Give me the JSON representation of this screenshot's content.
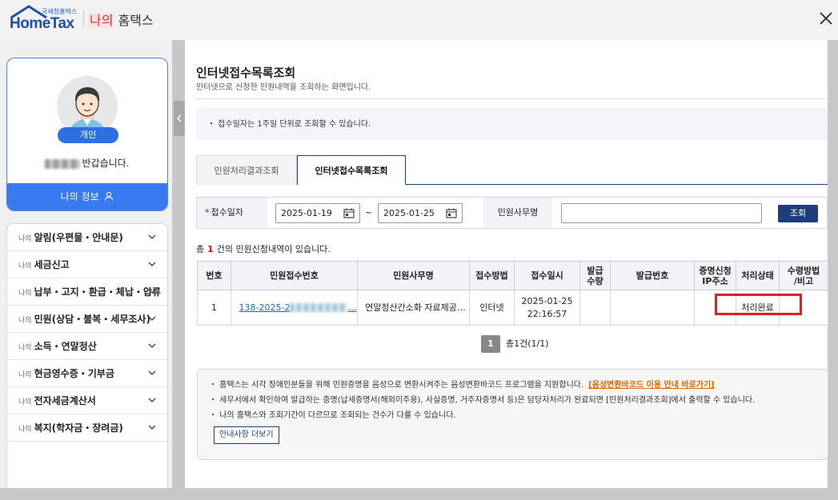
{
  "header": {
    "logo_small": "국세청홈택스",
    "logo_main": "HomeTax",
    "title_na": "나의",
    "title_rest": "홈택스"
  },
  "profile": {
    "badge": "개인",
    "greeting_suffix": "반갑습니다.",
    "myinfo_label": "나의 정보"
  },
  "menu": {
    "prefix": "나의",
    "items": [
      "알림(우편물・안내문)",
      "세금신고",
      "납부・고지・환급・체납・압류",
      "민원(상담・불복・세무조사)",
      "소득・연말정산",
      "현금영수증・기부금",
      "전자세금계산서",
      "복지(학자금・장려금)"
    ]
  },
  "page": {
    "title": "인터넷접수목록조회",
    "description": "인터넷으로 신청한 민원내역을 조회하는 화면입니다.",
    "notice": "・ 접수일자는 1주일 단위로 조회할 수 있습니다."
  },
  "tabs": [
    "민원처리결과조회",
    "인터넷접수목록조회"
  ],
  "search": {
    "date_label": "접수일자",
    "required_mark": "*",
    "date_from": "2025-01-19",
    "date_to": "2025-01-25",
    "tilde": "~",
    "service_label": "민원사무명",
    "service_value": "",
    "button": "조회"
  },
  "result": {
    "prefix": "총",
    "count": "1",
    "suffix": "건의 민원신청내역이 있습니다."
  },
  "table": {
    "headers": [
      "번호",
      "민원접수번호",
      "민원사무명",
      "접수방법",
      "접수일시",
      "발급\n수량",
      "발급번호",
      "증명신청\nIP주소",
      "처리상태",
      "수령방법\n/비고"
    ],
    "rows": [
      {
        "no": "1",
        "receipt_prefix": "138-2025-2",
        "receipt_ellipsis": "…",
        "service": "연말정산간소화 자료제공…",
        "method": "인터넷",
        "date": "2025-01-25",
        "time": "22:16:57",
        "qty": "",
        "issue_no": "",
        "ip": "",
        "status": "처리완료",
        "note": ""
      }
    ]
  },
  "pager": {
    "current": "1",
    "summary": "총1건(1/1)"
  },
  "info": {
    "line1": "・ 홈택스는 시각 장애인분들을 위해 민원증명을 음성으로 변환시켜주는 음성변환바코드 프로그램을 지원합니다.",
    "line1_link": "[음성변환바코드 이용 안내 바로가기]",
    "line2": "・ 세무서에서 확인하여 발급하는 증명(납세증명서(해외이주용), 사실증명, 거주자증명서 등)은 담당자처리가 완료되면 [민원처리결과조회]에서 출력할 수 있습니다.",
    "line3": "・ 나의 홈택스와 조회기간이 다르므로 조회되는 건수가 다를 수 있습니다.",
    "more_button": "안내사항 더보기"
  },
  "colors": {
    "brand_blue": "#1e4fa8",
    "accent_blue": "#3a7af0",
    "navy": "#1e3d7a",
    "highlight_red": "#e02020"
  }
}
